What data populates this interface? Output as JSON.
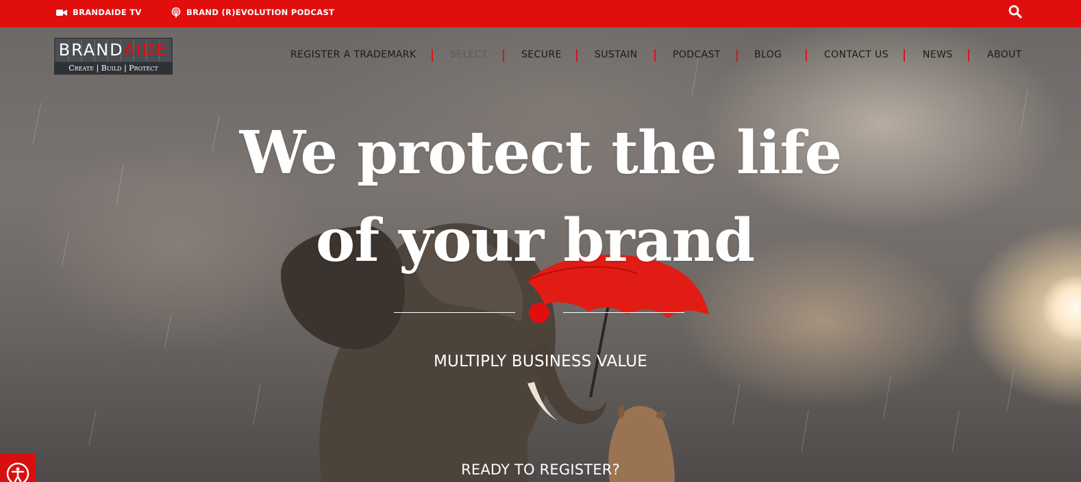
{
  "topbar": {
    "tv_label": "BRANDAIDE TV",
    "podcast_label": "BRAND (R)EVOLUTION PODCAST"
  },
  "logo": {
    "word_left": "BRAND",
    "word_right": "AIDE",
    "tagline": "Create | Build | Protect"
  },
  "nav": {
    "items": [
      {
        "label": "REGISTER A TRADEMARK"
      },
      {
        "label": "SELECT"
      },
      {
        "label": "SECURE"
      },
      {
        "label": "SUSTAIN"
      },
      {
        "label": "PODCAST"
      },
      {
        "label": "BLOG"
      },
      {
        "label": "CONTACT US"
      },
      {
        "label": "NEWS"
      },
      {
        "label": "ABOUT"
      }
    ]
  },
  "hero": {
    "headline_line1": "We protect the life",
    "headline_line2": "of your brand",
    "tagline": "MULTIPLY BUSINESS VALUE",
    "cta": "READY TO REGISTER?"
  },
  "colors": {
    "brand_red": "#e10e0e",
    "nav_text": "#1a1a1a",
    "active_nav": "#5b5b5b",
    "separator_red": "#d9141b"
  },
  "icons": {
    "tv": "video-camera-icon",
    "podcast": "podcast-icon",
    "search": "search-icon",
    "accessibility": "accessibility-icon"
  }
}
